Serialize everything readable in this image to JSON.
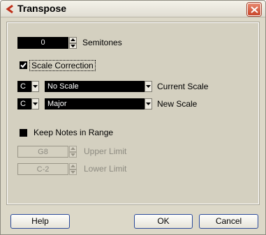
{
  "window": {
    "title": "Transpose"
  },
  "semitones": {
    "value": "0",
    "label": "Semitones"
  },
  "scale_correction": {
    "label": "Scale Correction",
    "checked": true
  },
  "current_scale": {
    "note": "C",
    "scale": "No Scale",
    "label": "Current Scale"
  },
  "new_scale": {
    "note": "C",
    "scale": "Major",
    "label": "New Scale"
  },
  "keep_notes": {
    "label": "Keep Notes in Range",
    "checked": false
  },
  "upper_limit": {
    "value": "G8",
    "label": "Upper Limit"
  },
  "lower_limit": {
    "value": "C-2",
    "label": "Lower Limit"
  },
  "buttons": {
    "help": "Help",
    "ok": "OK",
    "cancel": "Cancel"
  },
  "colors": {
    "accent_red": "#c8452a",
    "panel": "#d4d0c0",
    "field": "#000000"
  }
}
